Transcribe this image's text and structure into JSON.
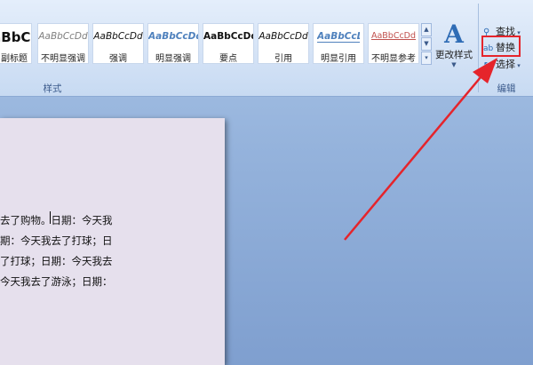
{
  "ribbon": {
    "styles_group": {
      "label": "样式",
      "tiles": [
        {
          "sample": "AaBbC",
          "name": "副标题",
          "color": "#111111"
        },
        {
          "sample": "AaBbCcDd",
          "name": "不明显强调",
          "color": "#7f7f7f"
        },
        {
          "sample": "AaBbCcDd",
          "name": "强调",
          "color": "#111111"
        },
        {
          "sample": "AaBbCcDd",
          "name": "明显强调",
          "color": "#4f81bd"
        },
        {
          "sample": "AaBbCcDd",
          "name": "要点",
          "color": "#111111"
        },
        {
          "sample": "AaBbCcDd",
          "name": "引用",
          "color": "#111111"
        },
        {
          "sample": "AaBbCcDd",
          "name": "明显引用",
          "color": "#4f81bd"
        },
        {
          "sample": "AaBbCcDd",
          "name": "不明显参考",
          "color": "#c0504d"
        }
      ],
      "change_styles_label": "更改样式"
    },
    "edit_group": {
      "label": "编辑",
      "find_label": "查找",
      "replace_label": "替换",
      "select_label": "选择"
    }
  },
  "document": {
    "lines": [
      "去了购物。日期：今天我",
      "期：今天我去了打球；日",
      "了打球；日期：今天我去",
      "今天我去了游泳；日期："
    ]
  },
  "annotation": {
    "arrow_color": "#e5242b"
  }
}
